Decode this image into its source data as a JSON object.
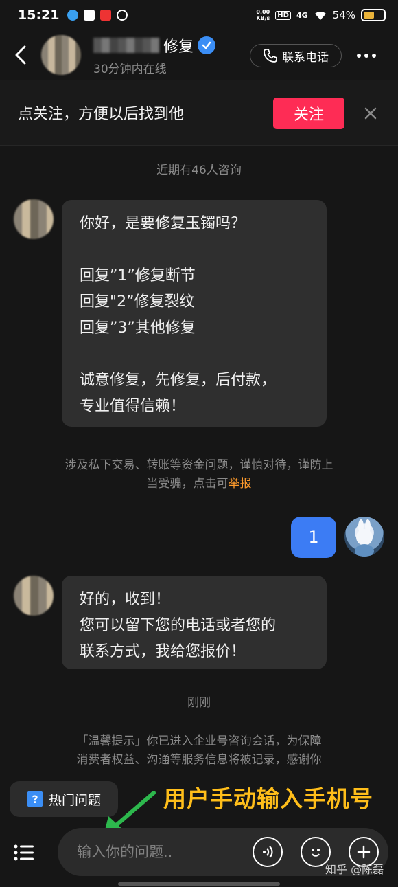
{
  "status_bar": {
    "time": "15:21",
    "network_speed": "0.00\nKB/s",
    "hd": "HD",
    "signal": "4G",
    "battery": "54%",
    "battery_level": 0.54
  },
  "header": {
    "title": "修复",
    "subtitle": "30分钟内在线",
    "phone_label": "联系电话"
  },
  "follow_bar": {
    "text": "点关注，方便以后找到他",
    "follow_label": "关注"
  },
  "notes": {
    "consult_count": "近期有46人咨询",
    "just_now": "刚刚"
  },
  "messages": {
    "greeting": [
      "你好，是要修复玉镯吗？",
      "",
      "回复”1”修复断节",
      "回复\"2”修复裂纹",
      "回复”3”其他修复",
      "",
      "诚意修复，先修复，后付款，",
      "专业值得信赖！"
    ],
    "user_reply": "1",
    "received": [
      "好的，收到！",
      "您可以留下您的电话或者您的",
      "联系方式，我给您报价！"
    ]
  },
  "warning": {
    "text": "涉及私下交易、转账等资金问题，谨慎对待，谨防上当受骗，点击可",
    "link": "举报"
  },
  "tip": {
    "line1": "「温馨提示」你已进入企业号咨询会话，为保障",
    "line2": "消费者权益、沟通等服务信息将被记录，感谢你"
  },
  "hot_questions": {
    "label": "热门问题"
  },
  "annotation": "用户手动输入手机号",
  "input": {
    "placeholder": "输入你的问题.."
  },
  "watermark": "知乎 @陈磊",
  "colors": {
    "follow": "#fe2c55",
    "user_bubble": "#3c7cf4",
    "report": "#fe9b2c",
    "annotation": "#ffbe1a",
    "arrow": "#2db84d"
  }
}
